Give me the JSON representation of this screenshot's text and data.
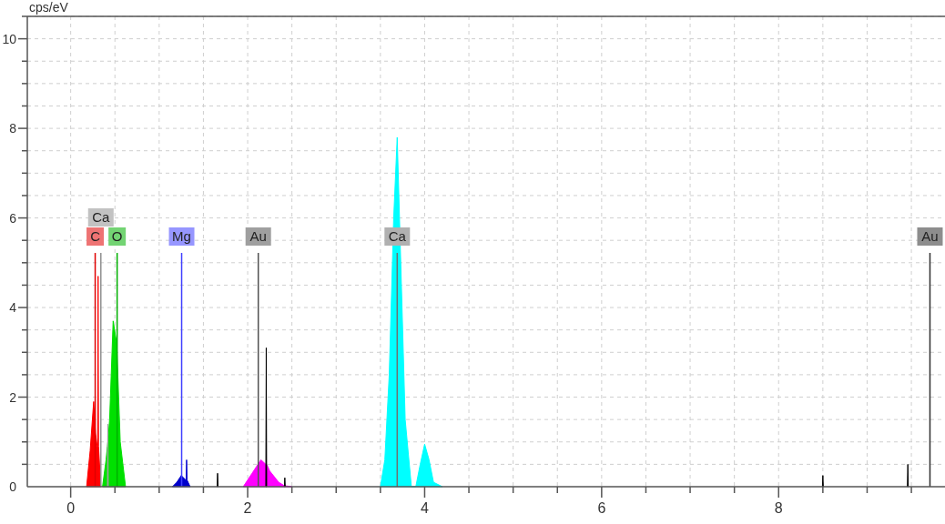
{
  "chart_data": {
    "type": "area",
    "ylabel": "cps/eV",
    "xlim": [
      -0.49,
      9.88
    ],
    "ylim": [
      0,
      10.5
    ],
    "grid": true,
    "xticks": [
      0,
      2,
      4,
      6,
      8
    ],
    "yticks": [
      0,
      2,
      4,
      6,
      8,
      10
    ],
    "x": [
      0.18,
      0.22,
      0.26,
      0.28,
      0.3,
      0.305,
      0.31,
      0.315,
      0.34,
      0.36,
      0.4,
      0.415,
      0.42,
      0.425,
      0.44,
      0.48,
      0.52,
      0.56,
      0.62,
      1.15,
      1.2,
      1.25,
      1.3,
      1.305,
      1.31,
      1.315,
      1.35,
      1.655,
      1.66,
      1.665,
      1.95,
      2.05,
      2.15,
      2.205,
      2.21,
      2.215,
      2.25,
      2.35,
      2.415,
      2.42,
      2.425,
      2.5,
      3.5,
      3.55,
      3.6,
      3.65,
      3.69,
      3.73,
      3.78,
      3.85,
      3.9,
      3.95,
      4.0,
      4.05,
      4.1,
      4.2,
      8.495,
      8.5,
      8.505,
      9.455,
      9.46,
      9.465
    ],
    "series": [
      {
        "color": "#ff0000",
        "values": [
          0,
          0.8,
          1.9,
          1.2,
          0.9,
          0.9,
          4.7,
          0.9,
          0,
          null,
          null,
          null,
          null,
          null,
          null,
          null,
          null,
          null,
          null,
          null,
          null,
          null,
          null,
          null,
          null,
          null,
          null,
          null,
          null,
          null,
          null,
          null,
          null,
          null,
          null,
          null,
          null,
          null,
          null,
          null,
          null,
          null,
          null,
          null,
          null,
          null,
          null,
          null,
          null,
          null,
          null,
          null,
          null,
          null,
          null,
          null,
          null,
          null,
          null,
          null,
          null,
          null
        ]
      },
      {
        "color": "#00e000",
        "values": [
          null,
          null,
          null,
          null,
          null,
          null,
          null,
          null,
          null,
          0,
          0.6,
          0.9,
          1.0,
          1.1,
          1.5,
          3.7,
          3.2,
          1.0,
          0,
          null,
          null,
          null,
          null,
          null,
          null,
          null,
          null,
          null,
          null,
          null,
          null,
          null,
          null,
          null,
          null,
          null,
          null,
          null,
          null,
          null,
          null,
          null,
          null,
          null,
          null,
          null,
          null,
          null,
          null,
          null,
          null,
          null,
          null,
          null,
          null,
          null,
          null,
          null,
          null,
          null,
          null,
          null
        ]
      },
      {
        "color": "#a0a0a0",
        "values": [
          null,
          null,
          null,
          null,
          null,
          null,
          null,
          null,
          null,
          null,
          null,
          0,
          1.4,
          0,
          null,
          null,
          null,
          null,
          null,
          null,
          null,
          null,
          null,
          null,
          null,
          null,
          null,
          null,
          null,
          null,
          null,
          null,
          null,
          null,
          null,
          null,
          null,
          null,
          null,
          null,
          null,
          null,
          null,
          null,
          null,
          null,
          null,
          null,
          null,
          null,
          null,
          null,
          null,
          null,
          null,
          null,
          null,
          null,
          null,
          null,
          null,
          null
        ]
      },
      {
        "color": "#0000cc",
        "values": [
          null,
          null,
          null,
          null,
          null,
          null,
          null,
          null,
          null,
          null,
          null,
          null,
          null,
          null,
          null,
          null,
          null,
          null,
          null,
          0,
          0.1,
          0.25,
          0.15,
          0.15,
          0.6,
          0.15,
          0,
          null,
          null,
          null,
          null,
          null,
          null,
          null,
          null,
          null,
          null,
          null,
          null,
          null,
          null,
          null,
          null,
          null,
          null,
          null,
          null,
          null,
          null,
          null,
          null,
          null,
          null,
          null,
          null,
          null,
          null,
          null,
          null,
          null,
          null,
          null
        ]
      },
      {
        "color": "#ff00ff",
        "values": [
          null,
          null,
          null,
          null,
          null,
          null,
          null,
          null,
          null,
          null,
          null,
          null,
          null,
          null,
          null,
          null,
          null,
          null,
          null,
          null,
          null,
          null,
          null,
          null,
          null,
          null,
          null,
          null,
          null,
          null,
          0,
          0.3,
          0.6,
          0.5,
          0.5,
          0.5,
          0.35,
          0.1,
          0.02,
          0.02,
          0.02,
          0,
          null,
          null,
          null,
          null,
          null,
          null,
          null,
          null,
          null,
          null,
          null,
          null,
          null,
          null,
          null,
          null,
          null,
          null,
          null,
          null
        ]
      },
      {
        "color": "#00ffff",
        "values": [
          null,
          null,
          null,
          null,
          null,
          null,
          null,
          null,
          null,
          null,
          null,
          null,
          null,
          null,
          null,
          null,
          null,
          null,
          null,
          null,
          null,
          null,
          null,
          null,
          null,
          null,
          null,
          null,
          null,
          null,
          null,
          null,
          null,
          null,
          null,
          null,
          null,
          null,
          null,
          null,
          null,
          null,
          0,
          0.6,
          2.5,
          6,
          7.8,
          5,
          1.5,
          0,
          0,
          0.5,
          0.95,
          0.6,
          0.1,
          0,
          null,
          null,
          null,
          null,
          null,
          null
        ]
      },
      {
        "color": "#000000",
        "values": [
          null,
          null,
          null,
          null,
          null,
          null,
          null,
          null,
          null,
          null,
          null,
          null,
          null,
          null,
          null,
          null,
          null,
          null,
          null,
          null,
          null,
          null,
          null,
          null,
          null,
          null,
          null,
          0,
          0.3,
          0,
          null,
          null,
          null,
          0,
          3.1,
          0,
          null,
          null,
          0,
          0.2,
          0,
          null,
          null,
          null,
          null,
          null,
          null,
          null,
          null,
          null,
          null,
          null,
          null,
          null,
          null,
          null,
          0,
          0.25,
          0,
          null,
          null,
          null
        ]
      },
      {
        "color": "#000000",
        "values": [
          null,
          null,
          null,
          null,
          null,
          null,
          null,
          null,
          null,
          null,
          null,
          null,
          null,
          null,
          null,
          null,
          null,
          null,
          null,
          null,
          null,
          null,
          null,
          null,
          null,
          null,
          null,
          null,
          null,
          null,
          null,
          null,
          null,
          null,
          null,
          null,
          null,
          null,
          null,
          null,
          null,
          null,
          null,
          null,
          null,
          null,
          null,
          null,
          null,
          null,
          null,
          null,
          null,
          null,
          null,
          null,
          null,
          null,
          null,
          0,
          0.5,
          0
        ]
      }
    ],
    "ref_lines": [
      {
        "axis": "x",
        "value": 0.277,
        "label": "C",
        "color": "#e00000"
      },
      {
        "axis": "x",
        "value": 0.341,
        "label": "Ca",
        "color": "#909090"
      },
      {
        "axis": "x",
        "value": 0.525,
        "label": "O",
        "color": "#00b000"
      },
      {
        "axis": "x",
        "value": 1.254,
        "label": "Mg",
        "color": "#4040ff"
      },
      {
        "axis": "x",
        "value": 2.12,
        "label": "Au",
        "color": "#505050"
      },
      {
        "axis": "x",
        "value": 3.69,
        "label": "Ca",
        "color": "#707070"
      },
      {
        "axis": "x",
        "value": 9.71,
        "label": "Au",
        "color": "#303030"
      }
    ]
  }
}
